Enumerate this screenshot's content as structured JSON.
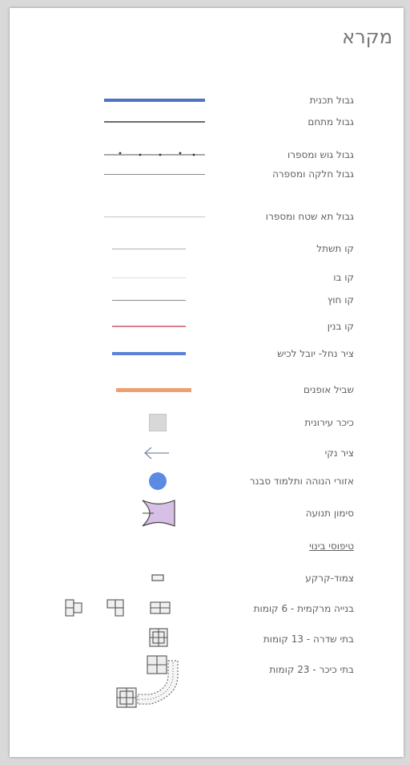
{
  "title": "מקרא",
  "legend": [
    {
      "label": "גבול תכנית",
      "symbol": "thick-blue-line",
      "color": "#4f72c7"
    },
    {
      "label": "גבול מתחם",
      "symbol": "thin-gray-line",
      "color": "#6b6b6b"
    },
    {
      "label": "גבול גוש ומספרו",
      "symbol": "dotted-boundary-line",
      "color": "#555555"
    },
    {
      "label": "גבול חלקה ומספרה",
      "symbol": "thin-gray-line",
      "color": "#8a8a8a"
    },
    {
      "label": "גבול תא שטח ומספרו",
      "symbol": "light-gray-line",
      "color": "#c4c4c4"
    },
    {
      "label": "קו תשתל",
      "symbol": "light-gray-line",
      "color": "#b0b0b0"
    },
    {
      "label": "קו בו",
      "symbol": "faint-line",
      "color": "#dddddd"
    },
    {
      "label": "קו חוץ",
      "symbol": "gray-line",
      "color": "#8a8a8a"
    },
    {
      "label": "קו בנין",
      "symbol": "red-line",
      "color": "#d9808a"
    },
    {
      "label": "ציר נחל- יובל לכיש",
      "symbol": "blue-line",
      "color": "#5b82d6"
    },
    {
      "label": "שביל אופנים",
      "symbol": "orange-line",
      "color": "#f0a070"
    },
    {
      "label": "כיכר עירונית",
      "symbol": "gray-square",
      "color": "#d8d8d8"
    },
    {
      "label": "ציר נקי",
      "symbol": "left-arrow-icon",
      "color": "#7d8aa6"
    },
    {
      "label": "אזורי הנוהה ותלמוד סבנר",
      "symbol": "blue-circle",
      "color": "#5b8be3"
    },
    {
      "label": "סימון תנועה",
      "symbol": "traffic-node-icon",
      "color": "#d7bfe6"
    },
    {
      "label": "טיפוסי בינוי",
      "symbol": "none",
      "color": "",
      "underline": true
    },
    {
      "label": "צמוד-קרקע",
      "symbol": "small-building-icon",
      "color": "#555555"
    },
    {
      "label": "בנייה מרקמית - 6 קומות",
      "symbol": "building-group-icons",
      "color": "#555555"
    },
    {
      "label": "בתי שדרה - 13 קומות",
      "symbol": "block-building-icon",
      "color": "#555555"
    },
    {
      "label": "בתי כיכר - 23 קומות",
      "symbol": "l-shaped-building-icon",
      "color": "#555555"
    }
  ]
}
